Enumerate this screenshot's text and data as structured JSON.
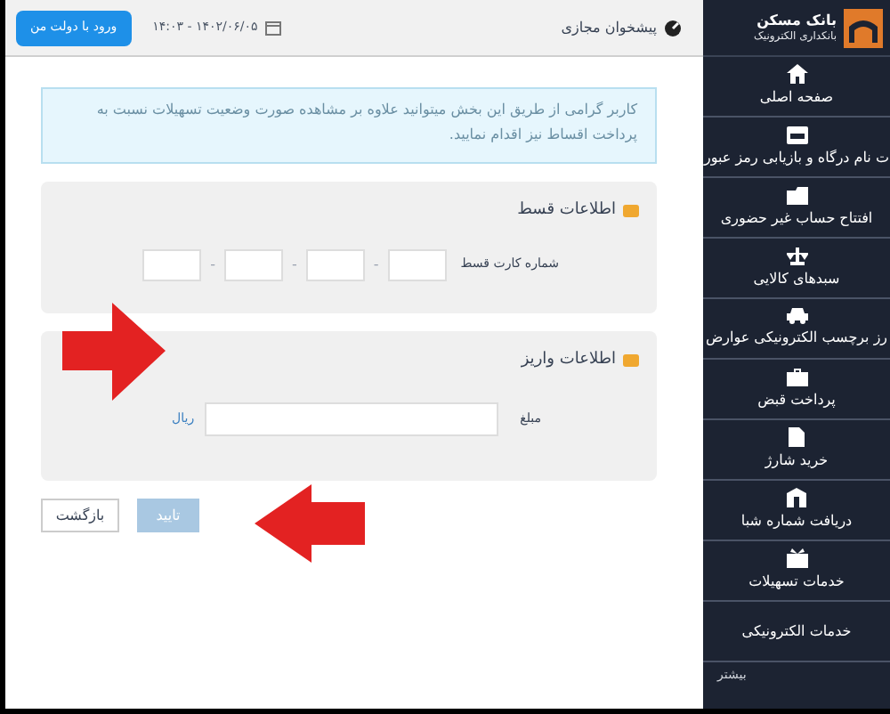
{
  "sidebar": {
    "bank_name": "بانک مسکن",
    "bank_subtitle": "بانکداری الکترونیک",
    "items": [
      {
        "label": "صفحه اصلی"
      },
      {
        "label": "ت نام درگاه و بازیابی رمز عبور"
      },
      {
        "label": "افتتاح حساب غیر حضوری"
      },
      {
        "label": "سبدهای کالایی"
      },
      {
        "label": "رز برچسب الکترونیکی عوارض"
      },
      {
        "label": "پرداخت قبض"
      },
      {
        "label": "خرید شارژ"
      },
      {
        "label": "دریافت شماره شبا"
      },
      {
        "label": "خدمات تسهیلات"
      },
      {
        "label": "خدمات الکترونیکی"
      }
    ],
    "more": "بیشتر"
  },
  "top_bar": {
    "title": "پیشخوان مجازی",
    "datetime": "۱۴۰۲/۰۶/۰۵ - ۱۴:۰۳",
    "login_button": "ورود با دولت من"
  },
  "info_message": "کاربر گرامی از طریق این بخش میتوانید علاوه بر مشاهده صورت وضعیت تسهیلات نسبت به پرداخت اقساط نیز اقدام نمایید.",
  "sections": [
    {
      "title": "اطلاعات قسط",
      "label": "شماره کارت قسط",
      "kind": "card",
      "segments": [
        {
          "kind": "field"
        },
        {
          "kind": "separator",
          "text": "-"
        },
        {
          "kind": "field"
        },
        {
          "kind": "separator",
          "text": "-"
        },
        {
          "kind": "field"
        },
        {
          "kind": "separator",
          "text": "-"
        },
        {
          "kind": "field"
        }
      ]
    },
    {
      "title": "اطلاعات واریز",
      "label": "مبلغ",
      "kind": "amount",
      "unit": "ریال"
    }
  ],
  "buttons": [
    {
      "label": "تایید",
      "disabled": true
    },
    {
      "label": "بازگشت",
      "disabled": false
    }
  ],
  "annotations": [
    {
      "kind": "arrow"
    },
    {
      "kind": "arrow"
    }
  ]
}
